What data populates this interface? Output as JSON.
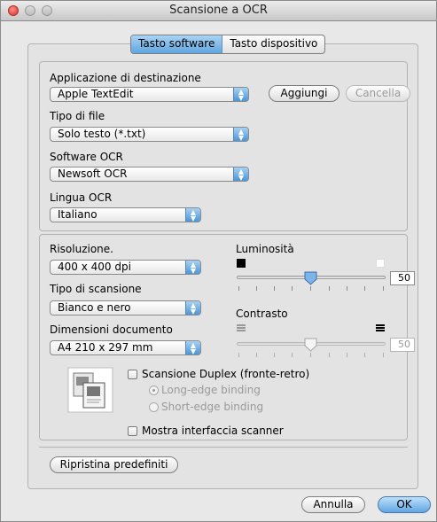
{
  "window": {
    "title": "Scansione a OCR"
  },
  "tabs": [
    {
      "label": "Tasto software",
      "selected": true
    },
    {
      "label": "Tasto dispositivo",
      "selected": false
    }
  ],
  "destination": {
    "app_label": "Applicazione di destinazione",
    "app_value": "Apple TextEdit",
    "add_button": "Aggiungi",
    "delete_button": "Cancella",
    "filetype_label": "Tipo di file",
    "filetype_value": "Solo testo (*.txt)",
    "ocr_software_label": "Software OCR",
    "ocr_software_value": "Newsoft OCR",
    "ocr_language_label": "Lingua OCR",
    "ocr_language_value": "Italiano"
  },
  "scan": {
    "resolution_label": "Risoluzione.",
    "resolution_value": "400 x 400 dpi",
    "scan_type_label": "Tipo di scansione",
    "scan_type_value": "Bianco e nero",
    "doc_size_label": "Dimensioni documento",
    "doc_size_value": "A4  210 x 297 mm",
    "brightness_label": "Luminosità",
    "brightness_value": "50",
    "contrast_label": "Contrasto",
    "contrast_value": "50",
    "duplex_label": "Scansione Duplex (fronte-retro)",
    "long_edge_label": "Long-edge binding",
    "short_edge_label": "Short-edge binding",
    "show_scanner_ui_label": "Mostra interfaccia scanner"
  },
  "buttons": {
    "restore_defaults": "Ripristina predefiniti",
    "cancel": "Annulla",
    "ok": "OK"
  },
  "colors": {
    "accent": "#5fa5e0",
    "window_bg": "#e8e8e8"
  }
}
